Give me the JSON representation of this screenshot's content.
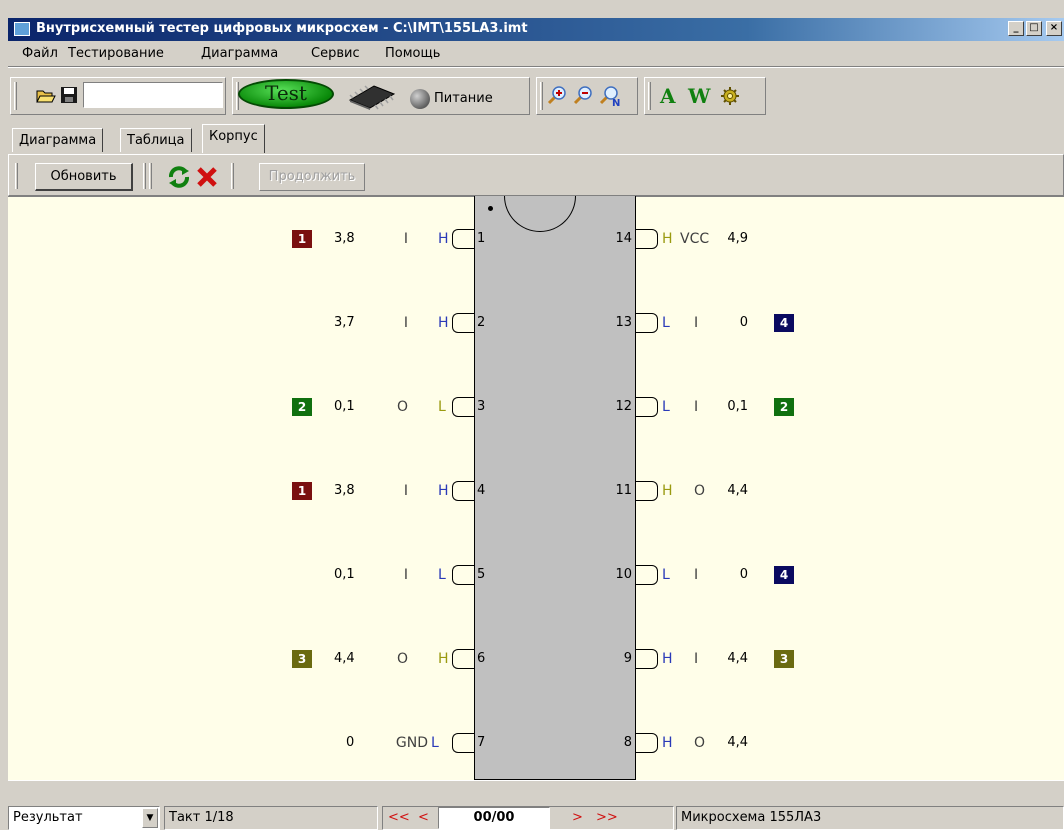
{
  "window": {
    "title": "Внутрисхемный тестер цифровых микросхем - C:\\IMT\\155LA3.imt",
    "minimize_glyph": "_",
    "maximize_glyph": "□",
    "close_glyph": "×"
  },
  "menu": [
    "Файл",
    "Тестирование",
    "Диаграмма",
    "Сервис",
    "Помощь"
  ],
  "toolbar": {
    "filename_value": "",
    "test_label": "Test",
    "power_label": "Питание",
    "font_a_label": "A",
    "font_w_label": "W"
  },
  "tabs": [
    {
      "label": "Диаграмма",
      "active": false
    },
    {
      "label": "Таблица",
      "active": false
    },
    {
      "label": "Корпус",
      "active": true
    }
  ],
  "subtoolbar": {
    "refresh_label": "Обновить",
    "continue_label": "Продолжить"
  },
  "colors": {
    "badge_1": "#7a1010",
    "badge_2": "#10700f",
    "badge_3": "#6a6a10",
    "badge_4": "#0a0a60",
    "level_H": "#2a3ab8",
    "level_L": "#2a3ab8",
    "level_out": "#9a9a10",
    "canvas_bg": "#fffee9",
    "chip_body": "#c0c0c0"
  },
  "pins_left": [
    {
      "num": "1",
      "dir": "I",
      "level": "H",
      "voltage": "3,8",
      "group": "1",
      "out": false
    },
    {
      "num": "2",
      "dir": "I",
      "level": "H",
      "voltage": "3,7",
      "group": "",
      "out": false
    },
    {
      "num": "3",
      "dir": "O",
      "level": "L",
      "voltage": "0,1",
      "group": "2",
      "out": true
    },
    {
      "num": "4",
      "dir": "I",
      "level": "H",
      "voltage": "3,8",
      "group": "1",
      "out": false
    },
    {
      "num": "5",
      "dir": "I",
      "level": "L",
      "voltage": "0,1",
      "group": "",
      "out": false
    },
    {
      "num": "6",
      "dir": "O",
      "level": "H",
      "voltage": "4,4",
      "group": "3",
      "out": true
    },
    {
      "num": "7",
      "dir": "GND",
      "level": "L",
      "voltage": "0",
      "group": "",
      "out": false
    }
  ],
  "pins_right": [
    {
      "num": "14",
      "dir": "VCC",
      "level": "H",
      "voltage": "4,9",
      "group": "",
      "out": true
    },
    {
      "num": "13",
      "dir": "I",
      "level": "L",
      "voltage": "0",
      "group": "4",
      "out": false
    },
    {
      "num": "12",
      "dir": "I",
      "level": "L",
      "voltage": "0,1",
      "group": "2",
      "out": false
    },
    {
      "num": "11",
      "dir": "O",
      "level": "H",
      "voltage": "4,4",
      "group": "",
      "out": true
    },
    {
      "num": "10",
      "dir": "I",
      "level": "L",
      "voltage": "0",
      "group": "4",
      "out": false
    },
    {
      "num": "9",
      "dir": "I",
      "level": "H",
      "voltage": "4,4",
      "group": "3",
      "out": false
    },
    {
      "num": "8",
      "dir": "O",
      "level": "H",
      "voltage": "4,4",
      "group": "",
      "out": false
    }
  ],
  "statusbar": {
    "view_select": "Результат",
    "step": "Такт 1/18",
    "first": "<<",
    "prev": "<",
    "counter": "00/00",
    "next": ">",
    "last": ">>",
    "chip": "Микросхема 155ЛА3"
  }
}
